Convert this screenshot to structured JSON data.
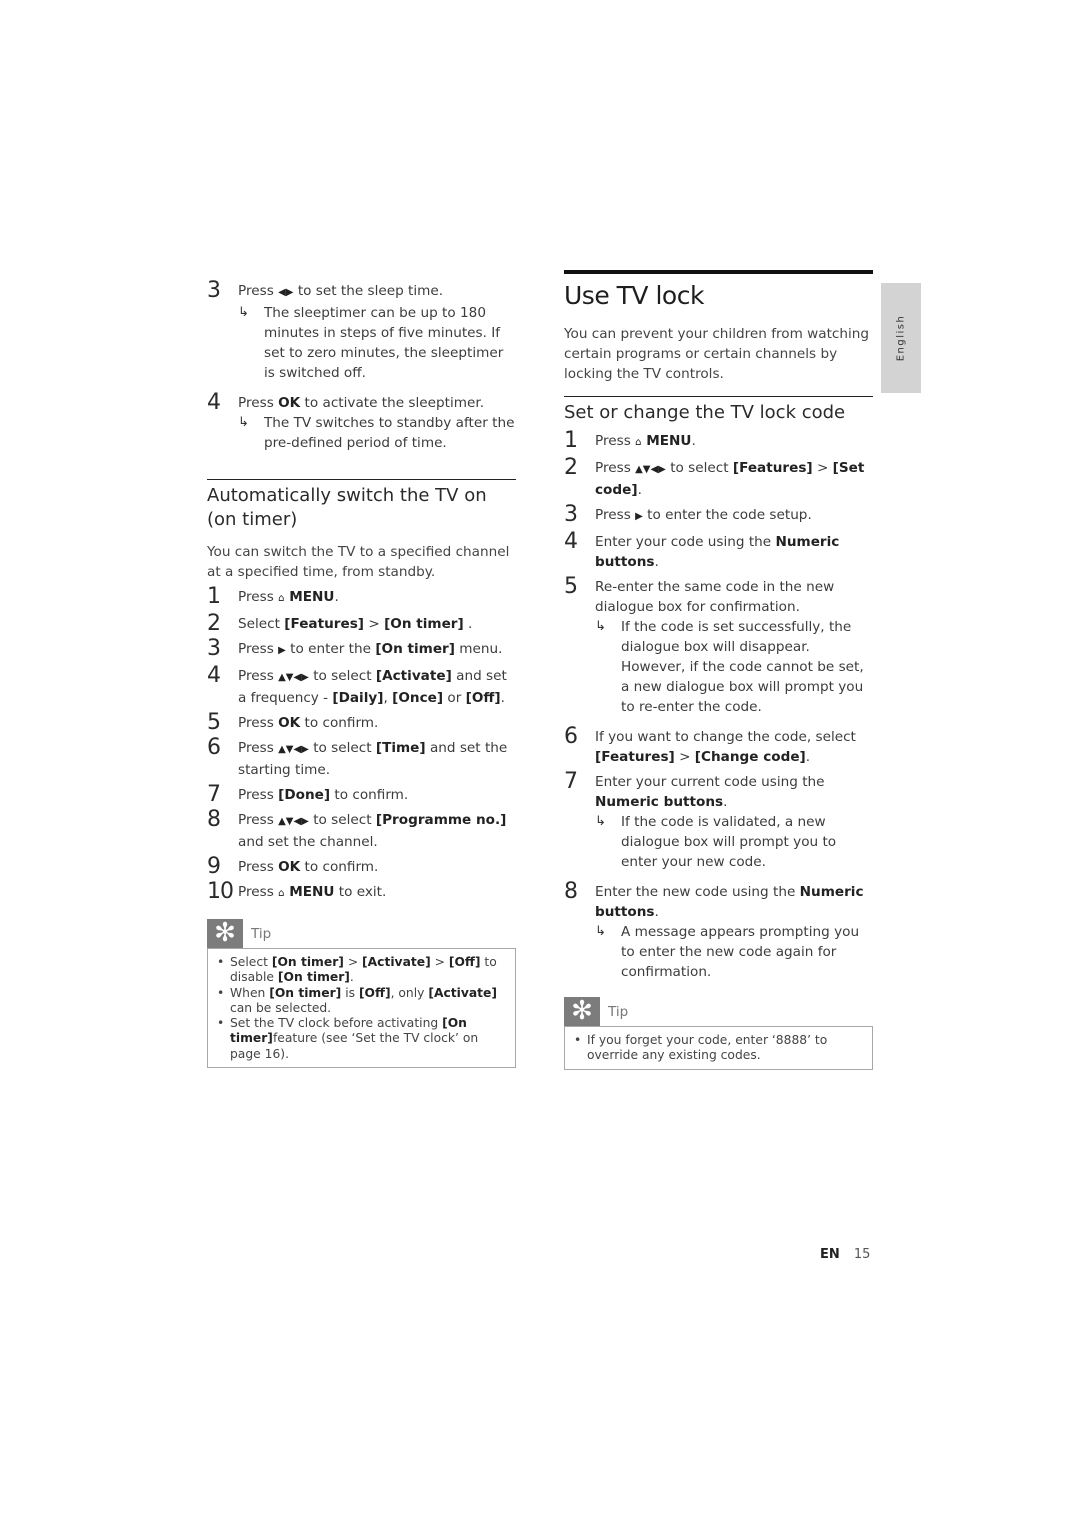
{
  "left_column": {
    "sleep_steps": [
      {
        "num": "3",
        "parts": [
          {
            "t": "Press "
          },
          {
            "t": "◀▶",
            "icon": "left-right-arrows"
          },
          {
            "t": " to set the sleep time."
          }
        ],
        "result": "The sleeptimer can be up to 180 minutes in steps of five minutes. If set to zero minutes, the sleeptimer is switched off."
      },
      {
        "num": "4",
        "parts": [
          {
            "t": "Press "
          },
          {
            "t": "OK",
            "bold": true
          },
          {
            "t": " to activate the sleeptimer."
          }
        ],
        "result": "The TV switches to standby after the pre-defined period of time."
      }
    ],
    "on_timer": {
      "heading": "Automatically switch the TV on (on timer)",
      "intro": "You can switch the TV to a specified channel at a specified time, from standby.",
      "steps": [
        {
          "num": "1",
          "parts": [
            {
              "t": "Press "
            },
            {
              "t": "⌂",
              "icon": "home-icon"
            },
            {
              "t": " MENU",
              "bold": true
            },
            {
              "t": "."
            }
          ]
        },
        {
          "num": "2",
          "parts": [
            {
              "t": "Select "
            },
            {
              "t": "[Features]",
              "bold": true
            },
            {
              "t": " > "
            },
            {
              "t": "[On timer]",
              "bold": true
            },
            {
              "t": " ."
            }
          ]
        },
        {
          "num": "3",
          "parts": [
            {
              "t": "Press "
            },
            {
              "t": "▶",
              "icon": "right-arrow"
            },
            {
              "t": " to enter the "
            },
            {
              "t": "[On timer]",
              "bold": true
            },
            {
              "t": " menu."
            }
          ]
        },
        {
          "num": "4",
          "parts": [
            {
              "t": "Press "
            },
            {
              "t": "▲▼◀▶",
              "icon": "navigation-arrows"
            },
            {
              "t": " to select "
            },
            {
              "t": "[Activate]",
              "bold": true
            },
            {
              "t": " and set a frequency - "
            },
            {
              "t": "[Daily]",
              "bold": true
            },
            {
              "t": ", "
            },
            {
              "t": "[Once]",
              "bold": true
            },
            {
              "t": " or "
            },
            {
              "t": "[Off]",
              "bold": true
            },
            {
              "t": "."
            }
          ]
        },
        {
          "num": "5",
          "parts": [
            {
              "t": "Press "
            },
            {
              "t": "OK",
              "bold": true
            },
            {
              "t": " to confirm."
            }
          ]
        },
        {
          "num": "6",
          "parts": [
            {
              "t": "Press "
            },
            {
              "t": "▲▼◀▶",
              "icon": "navigation-arrows"
            },
            {
              "t": " to select "
            },
            {
              "t": "[Time]",
              "bold": true
            },
            {
              "t": " and set the starting time."
            }
          ]
        },
        {
          "num": "7",
          "parts": [
            {
              "t": "Press "
            },
            {
              "t": "[Done]",
              "bold": true
            },
            {
              "t": " to confirm."
            }
          ]
        },
        {
          "num": "8",
          "parts": [
            {
              "t": "Press "
            },
            {
              "t": "▲▼◀▶",
              "icon": "navigation-arrows"
            },
            {
              "t": " to select "
            },
            {
              "t": "[Programme no.]",
              "bold": true
            },
            {
              "t": " and set the channel."
            }
          ]
        },
        {
          "num": "9",
          "parts": [
            {
              "t": "Press "
            },
            {
              "t": "OK",
              "bold": true
            },
            {
              "t": " to confirm."
            }
          ]
        },
        {
          "num": "10",
          "parts": [
            {
              "t": "Press "
            },
            {
              "t": "⌂",
              "icon": "home-icon"
            },
            {
              "t": " MENU",
              "bold": true
            },
            {
              "t": " to exit."
            }
          ]
        }
      ],
      "tip": {
        "label": "Tip",
        "icon": "tip-asterisk-icon",
        "items": [
          [
            {
              "t": "Select "
            },
            {
              "t": "[On timer]",
              "bold": true
            },
            {
              "t": " > "
            },
            {
              "t": "[Activate]",
              "bold": true
            },
            {
              "t": " > "
            },
            {
              "t": "[Off]",
              "bold": true
            },
            {
              "t": " to disable "
            },
            {
              "t": "[On timer]",
              "bold": true
            },
            {
              "t": "."
            }
          ],
          [
            {
              "t": "When "
            },
            {
              "t": "[On timer]",
              "bold": true
            },
            {
              "t": " is "
            },
            {
              "t": "[Off]",
              "bold": true
            },
            {
              "t": ", only "
            },
            {
              "t": "[Activate]",
              "bold": true
            },
            {
              "t": " can be selected."
            }
          ],
          [
            {
              "t": "Set the TV clock before activating "
            },
            {
              "t": "[On timer]",
              "bold": true
            },
            {
              "t": "feature (see ‘Set the TV clock’ on page 16)."
            }
          ]
        ]
      }
    }
  },
  "right_column": {
    "title": "Use TV lock",
    "intro": "You can prevent your children from watching certain programs or certain channels by locking the TV controls.",
    "section": {
      "heading": "Set or change the TV lock code",
      "steps": [
        {
          "num": "1",
          "parts": [
            {
              "t": "Press "
            },
            {
              "t": "⌂",
              "icon": "home-icon"
            },
            {
              "t": " MENU",
              "bold": true
            },
            {
              "t": "."
            }
          ]
        },
        {
          "num": "2",
          "parts": [
            {
              "t": "Press "
            },
            {
              "t": "▲▼◀▶",
              "icon": "navigation-arrows"
            },
            {
              "t": " to select "
            },
            {
              "t": "[Features]",
              "bold": true
            },
            {
              "t": " > "
            },
            {
              "t": "[Set code]",
              "bold": true
            },
            {
              "t": "."
            }
          ]
        },
        {
          "num": "3",
          "parts": [
            {
              "t": "Press "
            },
            {
              "t": "▶",
              "icon": "right-arrow"
            },
            {
              "t": " to enter the code setup."
            }
          ]
        },
        {
          "num": "4",
          "parts": [
            {
              "t": "Enter your code using the "
            },
            {
              "t": "Numeric buttons",
              "bold": true
            },
            {
              "t": "."
            }
          ]
        },
        {
          "num": "5",
          "parts": [
            {
              "t": "Re-enter the same code in the new dialogue box for confirmation."
            }
          ],
          "result": "If the code is set successfully, the dialogue box will disappear. However, if the code cannot be set, a new dialogue box will prompt you to re-enter the code."
        },
        {
          "num": "6",
          "parts": [
            {
              "t": "If you want to change the code, select "
            },
            {
              "t": "[Features]",
              "bold": true
            },
            {
              "t": " > "
            },
            {
              "t": "[Change code]",
              "bold": true
            },
            {
              "t": "."
            }
          ]
        },
        {
          "num": "7",
          "parts": [
            {
              "t": "Enter your current code using the "
            },
            {
              "t": "Numeric buttons",
              "bold": true
            },
            {
              "t": "."
            }
          ],
          "result": "If the code is validated, a new dialogue box will prompt you to enter your new code."
        },
        {
          "num": "8",
          "parts": [
            {
              "t": "Enter the new code using the "
            },
            {
              "t": "Numeric buttons",
              "bold": true
            },
            {
              "t": "."
            }
          ],
          "result": "A message appears prompting you to enter the new code again for confirmation."
        }
      ],
      "tip": {
        "label": "Tip",
        "icon": "tip-asterisk-icon",
        "items": [
          [
            {
              "t": "If you forget your code, enter ‘8888’ to override any existing codes."
            }
          ]
        ]
      }
    }
  },
  "side_tab": {
    "label": "English"
  },
  "footer": {
    "lang": "EN",
    "page": "15"
  },
  "result_arrow": "↳"
}
